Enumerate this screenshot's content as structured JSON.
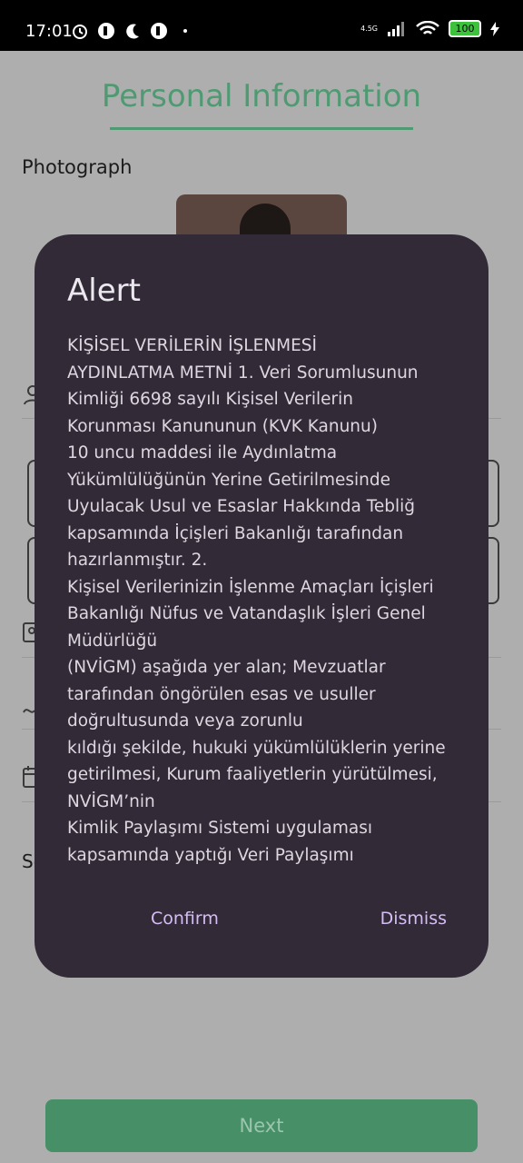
{
  "status_bar": {
    "time": "17:01",
    "network": "4.5G",
    "battery": "100"
  },
  "page": {
    "title": "Personal Information",
    "photo_label": "Photograph",
    "partial_label": "So",
    "next_label": "Next"
  },
  "dialog": {
    "title": "Alert",
    "body": " KİŞİSEL VERİLERİN İŞLENMESİ\nAYDINLATMA METNİ 1. Veri Sorumlusunun\nKimliği 6698 sayılı Kişisel Verilerin\nKorunması Kanununun (KVK Kanunu)\n10 uncu maddesi ile Aydınlatma\nYükümlülüğünün Yerine Getirilmesinde\nUyulacak Usul ve Esaslar Hakkında Tebliğ\nkapsamında İçişleri Bakanlığı tarafından\nhazırlanmıştır. 2.\nKişisel Verilerinizin İşlenme Amaçları İçişleri\nBakanlığı Nüfus ve Vatandaşlık İşleri Genel\nMüdürlüğü\n(NVİGM) aşağıda yer alan; Mevzuatlar\ntarafından öngörülen esas ve usuller\ndoğrultusunda veya zorunlu\nkıldığı şekilde, hukuki yükümlülüklerin yerine\ngetirilmesi, Kurum faaliyetlerin yürütülmesi,\nNVİGM’nin\nKimlik Paylaşımı Sistemi uygulaması\nkapsamında yaptığı Veri Paylaşımı",
    "confirm_label": "Confirm",
    "dismiss_label": "Dismiss"
  },
  "colors": {
    "accent": "#4f9a72",
    "dialog_bg": "#322a37",
    "dialog_button": "#d4bdf5"
  }
}
